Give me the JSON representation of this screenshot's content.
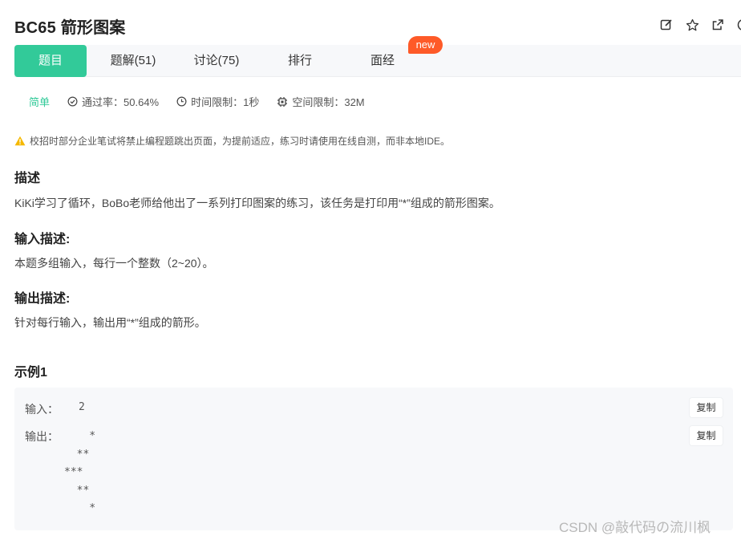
{
  "problem": {
    "title": "BC65  箭形图案"
  },
  "header_icons": [
    "edit-icon",
    "star-icon",
    "external-link-icon",
    "info-icon"
  ],
  "tabs": [
    {
      "label": "题目",
      "active": true
    },
    {
      "label": "题解(51)",
      "active": false
    },
    {
      "label": "讨论(75)",
      "active": false
    },
    {
      "label": "排行",
      "active": false
    },
    {
      "label": "面经",
      "active": false
    }
  ],
  "new_badge": "new",
  "meta": {
    "difficulty": "简单",
    "pass_rate": "通过率：50.64%",
    "time_limit": "时间限制：1秒",
    "space_limit": "空间限制：32M"
  },
  "notice": "校招时部分企业笔试将禁止编程题跳出页面，为提前适应，练习时请使用在线自测，而非本地IDE。",
  "sections": {
    "desc_title": "描述",
    "desc_text": "KiKi学习了循环，BoBo老师给他出了一系列打印图案的练习，该任务是打印用“*”组成的箭形图案。",
    "input_title": "输入描述:",
    "input_text": "本题多组输入，每行一个整数（2~20）。",
    "output_title": "输出描述:",
    "output_text": "针对每行输入，输出用“*”组成的箭形。"
  },
  "example": {
    "title": "示例1",
    "input_label": "输入：",
    "input_value": "2",
    "output_label": "输出：",
    "output_value": "    *\n  **\n***\n  **\n    *",
    "copy_label": "复制"
  },
  "watermark": "CSDN @敲代码の流川枫",
  "colors": {
    "accent": "#32ca99",
    "badge": "#fe5a28",
    "warning": "#f5b800"
  }
}
